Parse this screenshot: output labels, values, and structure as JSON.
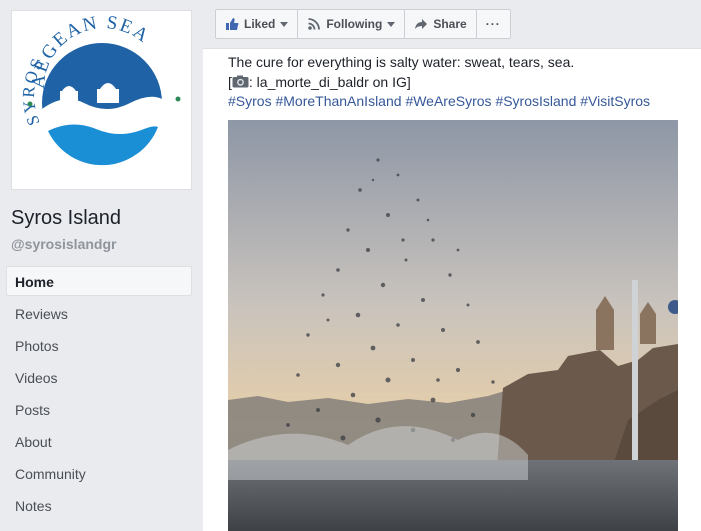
{
  "sidebar": {
    "logo": {
      "text_top": "AEGEAN SEA",
      "text_left": "SYROS"
    },
    "page_name": "Syros Island",
    "page_handle": "@syrosislandgr",
    "nav_items": [
      {
        "label": "Home"
      },
      {
        "label": "Reviews"
      },
      {
        "label": "Photos"
      },
      {
        "label": "Videos"
      },
      {
        "label": "Posts"
      },
      {
        "label": "About"
      },
      {
        "label": "Community"
      },
      {
        "label": "Notes"
      }
    ]
  },
  "actions": {
    "liked": "Liked",
    "following": "Following",
    "share": "Share",
    "more": "···"
  },
  "post": {
    "line1": "The cure for everything is salty water: sweat, tears, sea.",
    "credit": ": la_morte_di_baldr on IG]",
    "credit_open": "[",
    "camera_icon": "camera-icon",
    "hashtags": [
      "#Syros",
      "#MoreThanAnIsland",
      "#WeAreSyros",
      "#SyrosIsland",
      "#VisitSyros"
    ]
  },
  "colors": {
    "accent": "#365899",
    "logo_blue": "#1f63a6",
    "logo_green": "#2e8b57"
  }
}
